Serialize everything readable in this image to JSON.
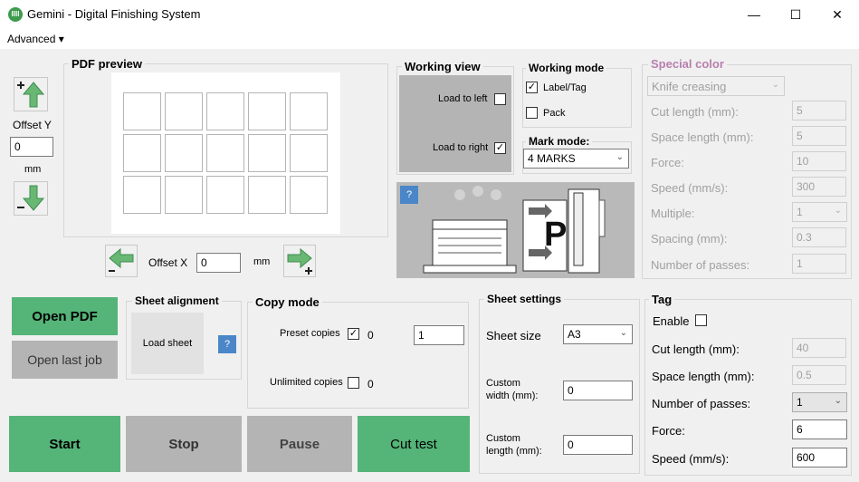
{
  "window": {
    "title": "Gemini - Digital Finishing System",
    "icon_text": "IIII",
    "minimize": "—",
    "maximize": "☐",
    "close": "✕"
  },
  "menu": {
    "advanced": "Advanced ▾"
  },
  "offset_y": {
    "label": "Offset Y",
    "value": "0",
    "unit": "mm"
  },
  "pdf_preview": {
    "title": "PDF preview",
    "rows": 3,
    "cols": 5
  },
  "offset_x": {
    "label": "Offset X",
    "value": "0",
    "unit": "mm"
  },
  "working_view": {
    "title": "Working view",
    "load_left": "Load to left",
    "load_left_checked": false,
    "load_right": "Load to right",
    "load_right_checked": true
  },
  "working_mode": {
    "title": "Working mode",
    "label_tag": "Label/Tag",
    "label_tag_checked": true,
    "pack": "Pack",
    "pack_checked": false
  },
  "mark_mode": {
    "title": "Mark mode:",
    "value": "4 MARKS"
  },
  "help": "?",
  "special_color": {
    "title": "Special color",
    "mode": "Knife creasing",
    "fields": [
      {
        "label": "Cut length (mm):",
        "value": "5"
      },
      {
        "label": "Space length (mm):",
        "value": "5"
      },
      {
        "label": "Force:",
        "value": "10"
      },
      {
        "label": "Speed (mm/s):",
        "value": "300"
      },
      {
        "label": "Multiple:",
        "value": "1"
      },
      {
        "label": "Spacing (mm):",
        "value": "0.3"
      },
      {
        "label": "Number of passes:",
        "value": "1"
      }
    ]
  },
  "buttons": {
    "open_pdf": "Open PDF",
    "open_last_job": "Open last job",
    "start": "Start",
    "stop": "Stop",
    "pause": "Pause",
    "cut_test": "Cut test",
    "load_sheet": "Load sheet"
  },
  "sheet_alignment": {
    "title": "Sheet alignment"
  },
  "copy_mode": {
    "title": "Copy mode",
    "preset": "Preset copies",
    "preset_checked": true,
    "preset_count": "0",
    "preset_value": "1",
    "unlimited": "Unlimited copies",
    "unlimited_checked": false,
    "unlimited_count": "0"
  },
  "sheet_settings": {
    "title": "Sheet settings",
    "size_label": "Sheet size",
    "size_value": "A3",
    "width_label_1": "Custom",
    "width_label_2": "width (mm):",
    "width_value": "0",
    "length_label_1": "Custom",
    "length_label_2": "length (mm):",
    "length_value": "0"
  },
  "tag": {
    "title": "Tag",
    "enable": "Enable",
    "enable_checked": false,
    "cut_length_label": "Cut length (mm):",
    "cut_length": "40",
    "space_length_label": "Space length (mm):",
    "space_length": "0.5",
    "passes_label": "Number of passes:",
    "passes": "1",
    "force_label": "Force:",
    "force": "6",
    "speed_label": "Speed (mm/s):",
    "speed": "600"
  },
  "colors": {
    "green": "#55b478",
    "gray": "#b4b4b4",
    "special_title": "#b87fae",
    "help_blue": "#4a86c8"
  }
}
